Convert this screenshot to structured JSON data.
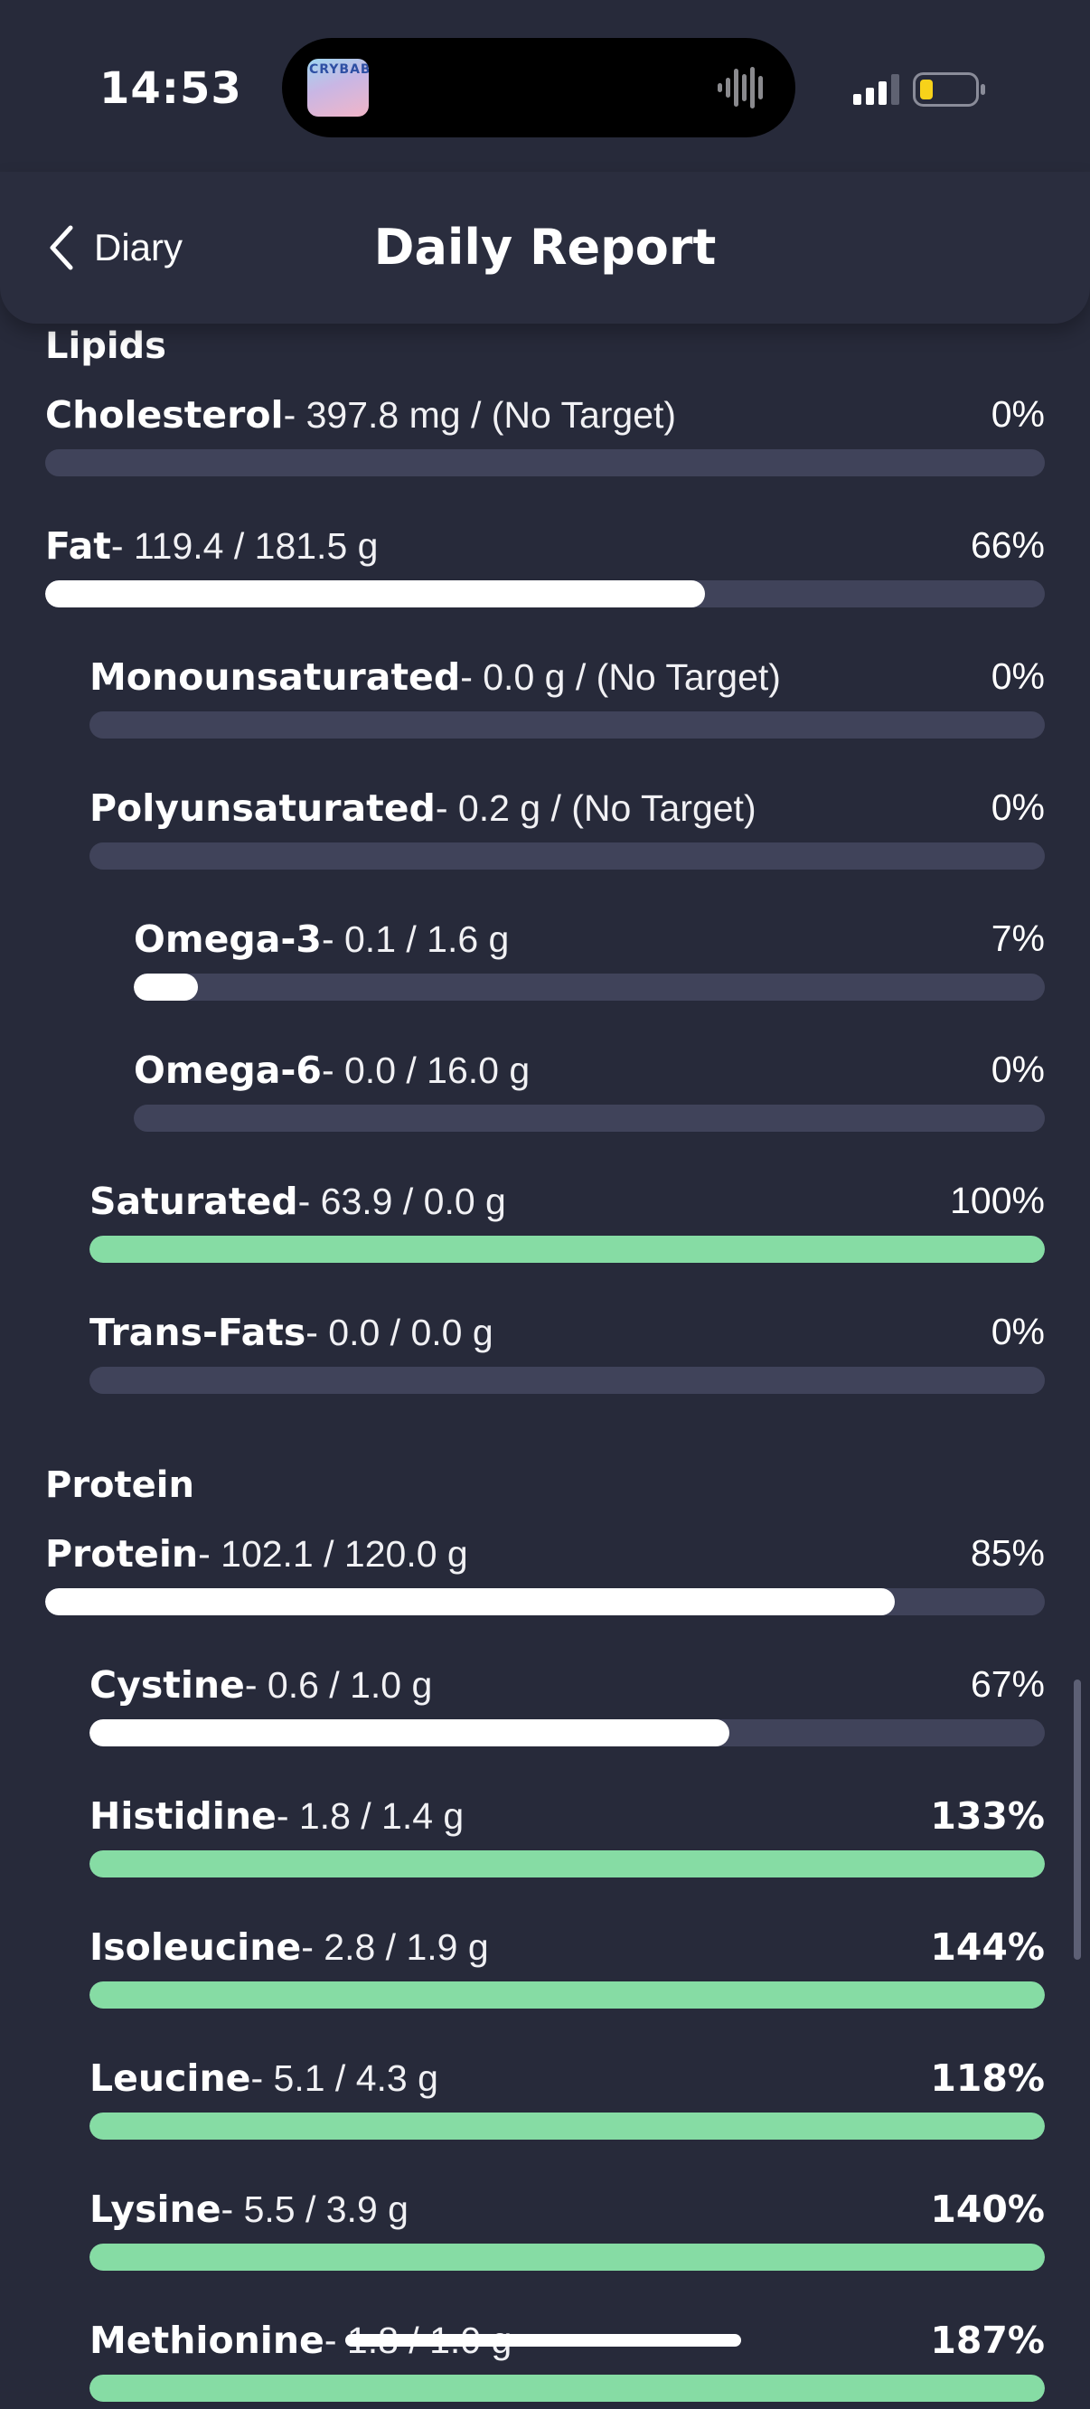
{
  "status_bar": {
    "time": "14:53",
    "island_art_text": "CRYBABY"
  },
  "nav": {
    "back_label": "Diary",
    "title": "Daily Report"
  },
  "sections": [
    {
      "title": "Lipids",
      "rows": [
        {
          "name": "Cholesterol",
          "detail": "- 397.8 mg / (No Target)",
          "pct": "0%",
          "fill": 0,
          "status": "normal",
          "indent": 0
        },
        {
          "name": "Fat",
          "detail": "- 119.4 / 181.5 g",
          "pct": "66%",
          "fill": 0.66,
          "status": "normal",
          "indent": 0
        },
        {
          "name": "Monounsaturated",
          "detail": "- 0.0 g / (No Target)",
          "pct": "0%",
          "fill": 0,
          "status": "normal",
          "indent": 1
        },
        {
          "name": "Polyunsaturated",
          "detail": "- 0.2 g / (No Target)",
          "pct": "0%",
          "fill": 0,
          "status": "normal",
          "indent": 1
        },
        {
          "name": "Omega-3",
          "detail": "- 0.1 / 1.6 g",
          "pct": "7%",
          "fill": 0.07,
          "status": "normal",
          "indent": 2
        },
        {
          "name": "Omega-6",
          "detail": "- 0.0 / 16.0 g",
          "pct": "0%",
          "fill": 0,
          "status": "normal",
          "indent": 2
        },
        {
          "name": "Saturated",
          "detail": "- 63.9 / 0.0 g",
          "pct": "100%",
          "fill": 1,
          "status": "met",
          "indent": 1
        },
        {
          "name": "Trans-Fats",
          "detail": "- 0.0 / 0.0 g",
          "pct": "0%",
          "fill": 0,
          "status": "normal",
          "indent": 1
        }
      ]
    },
    {
      "title": "Protein",
      "rows": [
        {
          "name": "Protein",
          "detail": "- 102.1 / 120.0 g",
          "pct": "85%",
          "fill": 0.85,
          "status": "normal",
          "indent": 0
        },
        {
          "name": "Cystine",
          "detail": "- 0.6 / 1.0 g",
          "pct": "67%",
          "fill": 0.67,
          "status": "normal",
          "indent": 1
        },
        {
          "name": "Histidine",
          "detail": "- 1.8 / 1.4 g",
          "pct": "133%",
          "fill": 1,
          "status": "over",
          "indent": 1
        },
        {
          "name": "Isoleucine",
          "detail": "- 2.8 / 1.9 g",
          "pct": "144%",
          "fill": 1,
          "status": "over",
          "indent": 1
        },
        {
          "name": "Leucine",
          "detail": "- 5.1 / 4.3 g",
          "pct": "118%",
          "fill": 1,
          "status": "over",
          "indent": 1
        },
        {
          "name": "Lysine",
          "detail": "- 5.5 / 3.9 g",
          "pct": "140%",
          "fill": 1,
          "status": "over",
          "indent": 1
        },
        {
          "name": "Methionine",
          "detail": "- 1.8 / 1.0 g",
          "pct": "187%",
          "fill": 1,
          "status": "over",
          "indent": 1
        }
      ]
    }
  ],
  "colors": {
    "background": "#272a3a",
    "track": "#40435a",
    "fill": "#ffffff",
    "fill_met": "#86dca4"
  }
}
